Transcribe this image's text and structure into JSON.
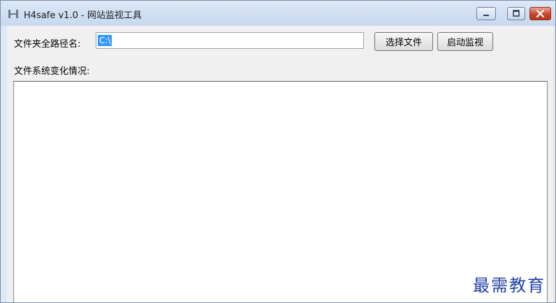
{
  "window": {
    "title": "H4safe v1.0 - 网站监视工具",
    "app_icon": "h4safe-logo-icon",
    "controls": [
      "minimize-icon",
      "maximize-icon",
      "close-icon"
    ]
  },
  "form": {
    "path_label": "文件夹全路径名:",
    "path_value": "C:\\",
    "choose_button": "选择文件",
    "start_button": "启动监视",
    "changes_label": "文件系统变化情况:"
  },
  "watermark": {
    "text": "最需教育"
  },
  "colors": {
    "selection": "#3399ff",
    "close_button": "#c9442a",
    "watermark": "#1f3fa6"
  }
}
